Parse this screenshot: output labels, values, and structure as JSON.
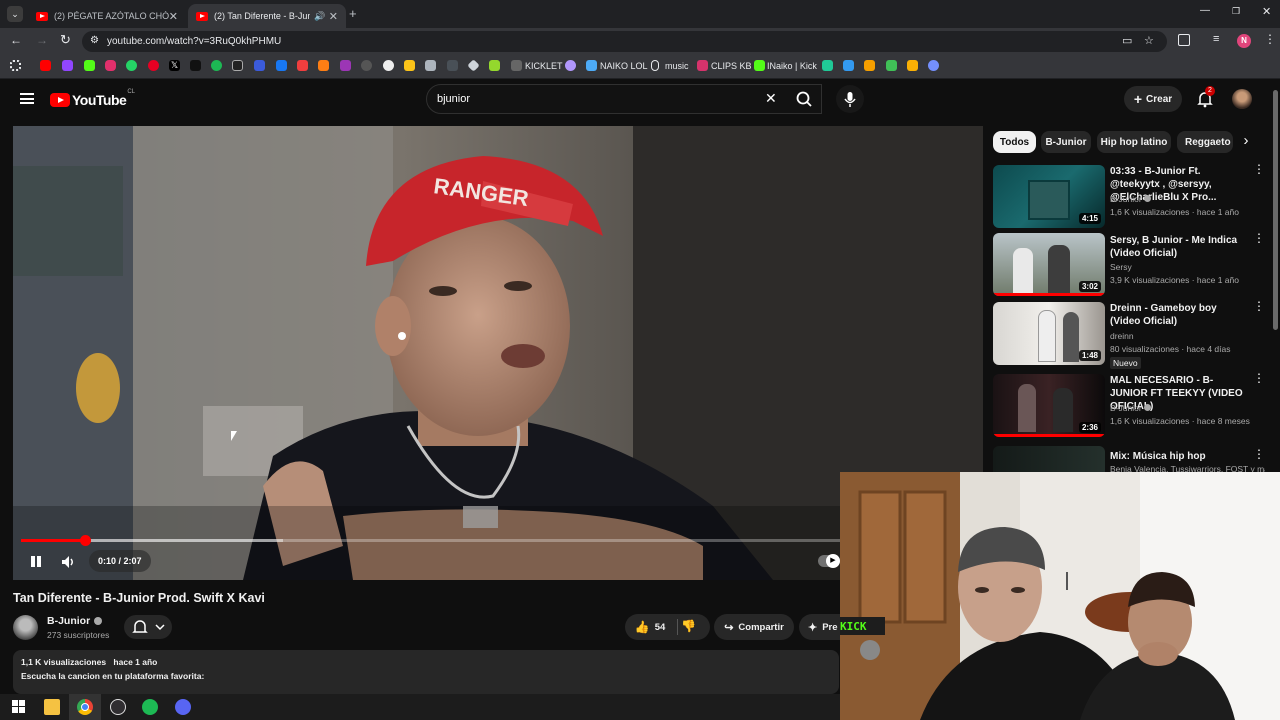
{
  "browser": {
    "tabs": [
      {
        "title": "(2) PÉGATE AZÓTALO CHÓCALO"
      },
      {
        "title": "(2) Tan Diferente - B-Junior"
      }
    ],
    "url": "youtube.com/watch?v=3RuQ0khPHMU",
    "bookmarks": [
      "KICKLET",
      "NAIKO LOL",
      "music",
      "CLIPS KB",
      "INaiko | Kick"
    ],
    "profile_initial": "N"
  },
  "youtube": {
    "logo": "YouTube",
    "country": "CL",
    "search_value": "bjunior",
    "create_label": "Crear",
    "notif_count": "2"
  },
  "player": {
    "time": "0:10 / 2:07",
    "progress": 0.078,
    "cap_text": "RANGER"
  },
  "video": {
    "title": "Tan Diferente - B-Junior Prod. Swift X Kavi",
    "channel": "B-Junior",
    "subscribers": "273 suscriptores",
    "likes": "54",
    "share_label": "Compartir",
    "premium_label": "Pre",
    "views": "1,1 K visualizaciones",
    "age": "hace 1 año",
    "description": "Escucha la cancion en tu plataforma favorita:"
  },
  "chips": [
    "Todos",
    "B-Junior",
    "Hip hop latino",
    "Reggaeto"
  ],
  "sidebar": [
    {
      "title": "03:33 - B-Junior Ft. @teekyytx , @sersyy, @ElCharlieBlu X Pro...",
      "channel": "B-Junior",
      "meta": "1,6 K visualizaciones · hace 1 año",
      "duration": "4:15"
    },
    {
      "title": "Sersy, B Junior - Me Indica (Video Oficial)",
      "channel": "Sersy",
      "meta": "3,9 K visualizaciones · hace 1 año",
      "duration": "3:02"
    },
    {
      "title": "Dreinn - Gameboy boy (Video Oficial)",
      "channel": "dreinn",
      "meta": "80 visualizaciones · hace 4 días",
      "duration": "1:48",
      "badge": "Nuevo"
    },
    {
      "title": "MAL NECESARIO - B-JUNIOR FT TEEKYY (VIDEO OFICIAL)",
      "channel": "B-Junior",
      "meta": "1,6 K visualizaciones · hace 8 meses",
      "duration": "2:36"
    },
    {
      "title": "Mix: Música hip hop",
      "channel": "Benja Valencia, Tussiwarriors, FOST y más",
      "meta": "",
      "duration": ""
    }
  ]
}
